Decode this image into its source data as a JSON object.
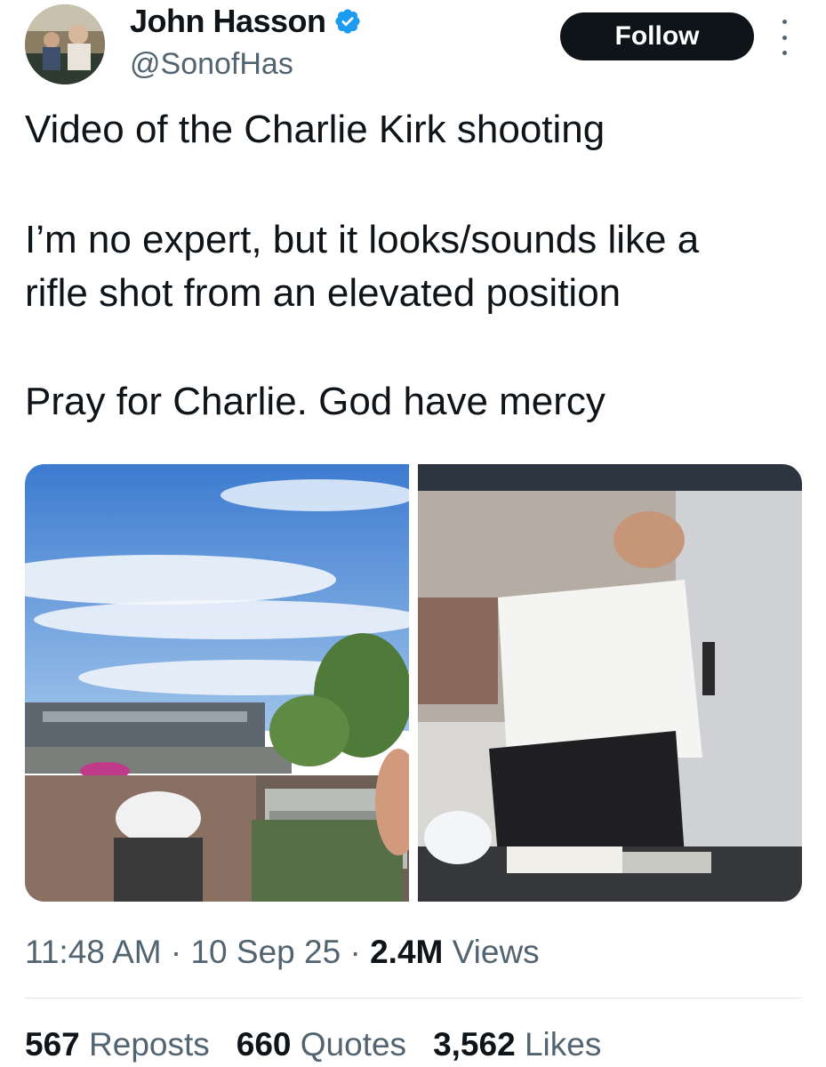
{
  "author": {
    "name": "John Hasson",
    "handle": "@SonofHas",
    "verified": true,
    "avatar_icon": "profile-photo"
  },
  "follow_label": "Follow",
  "more_icon": "more-options-icon",
  "tweet": {
    "lines": [
      "Video of the Charlie Kirk shooting",
      "I’m no expert, but it looks/sounds like a",
      "rifle shot from an elevated position",
      "Pray for Charlie. God have mercy"
    ]
  },
  "media": [
    {
      "type": "photo"
    },
    {
      "type": "photo"
    }
  ],
  "meta": {
    "time": "11:48 AM",
    "date": "10 Sep 25",
    "views_count": "2.4M",
    "views_label": "Views",
    "separator": "·"
  },
  "stats": [
    {
      "count": "567",
      "label": "Reposts"
    },
    {
      "count": "660",
      "label": "Quotes"
    },
    {
      "count": "3,562",
      "label": "Likes"
    }
  ],
  "colors": {
    "text": "#0f1419",
    "secondary": "#536471",
    "verified": "#1d9bf0",
    "button": "#0f1419"
  }
}
